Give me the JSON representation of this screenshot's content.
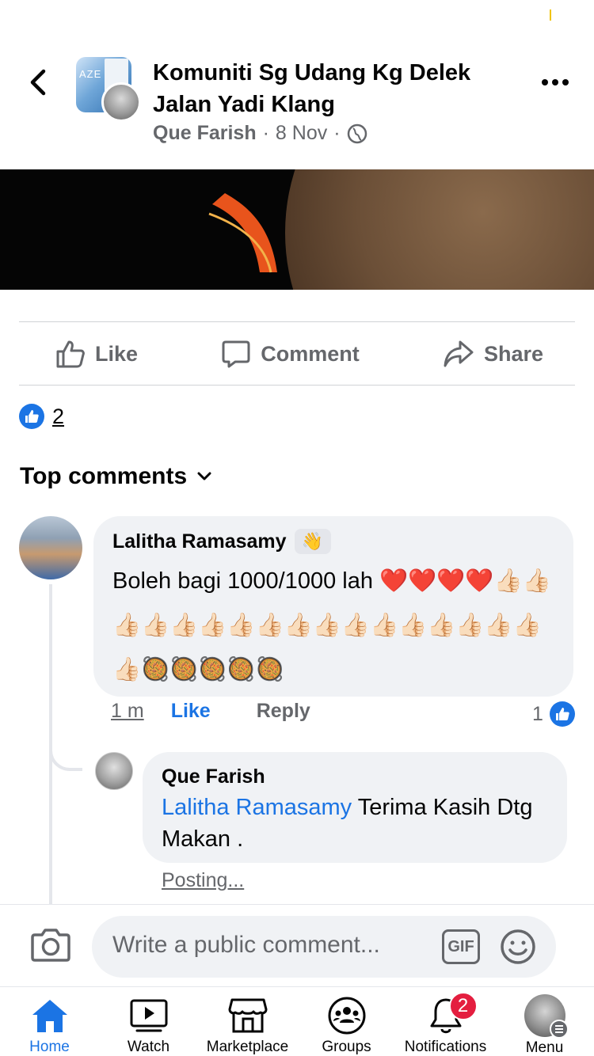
{
  "header": {
    "title": "Komuniti Sg Udang Kg Delek Jalan Yadi Klang",
    "author": "Que Farish",
    "separator": "·",
    "date": "8 Nov",
    "group_thumb_text": "AZE"
  },
  "actions": {
    "like": "Like",
    "comment": "Comment",
    "share": "Share"
  },
  "reactions": {
    "count": "2"
  },
  "comments_section": {
    "title": "Top comments"
  },
  "comments": [
    {
      "name": "Lalitha Ramasamy",
      "badge": "👋",
      "text": "Boleh bagi 1000/1000 lah ❤️❤️❤️❤️👍🏻👍🏻👍🏻👍🏻👍🏻👍🏻👍🏻👍🏻👍🏻👍🏻👍🏻👍🏻👍🏻👍🏻👍🏻👍🏻👍🏻👍🏻🥘🥘🥘🥘🥘",
      "time": "1 m",
      "like_label": "Like",
      "reply_label": "Reply",
      "reaction_count": "1"
    },
    {
      "name": "Que Farish",
      "mention": "Lalitha Ramasamy",
      "text": " Terima Kasih Dtg Makan .",
      "status": "Posting..."
    }
  ],
  "composer": {
    "placeholder": "Write a public comment...",
    "gif_label": "GIF"
  },
  "tabbar": {
    "items": [
      {
        "label": "Home",
        "icon": "home-icon",
        "active": true
      },
      {
        "label": "Watch",
        "icon": "watch-icon"
      },
      {
        "label": "Marketplace",
        "icon": "marketplace-icon"
      },
      {
        "label": "Groups",
        "icon": "groups-icon"
      },
      {
        "label": "Notifications",
        "icon": "bell-icon",
        "badge": "2"
      },
      {
        "label": "Menu",
        "icon": "menu-avatar"
      }
    ]
  },
  "colors": {
    "accent": "#1b74e4",
    "secondary_text": "#65676b",
    "bubble": "#f0f2f5",
    "badge": "#e41e3f"
  }
}
